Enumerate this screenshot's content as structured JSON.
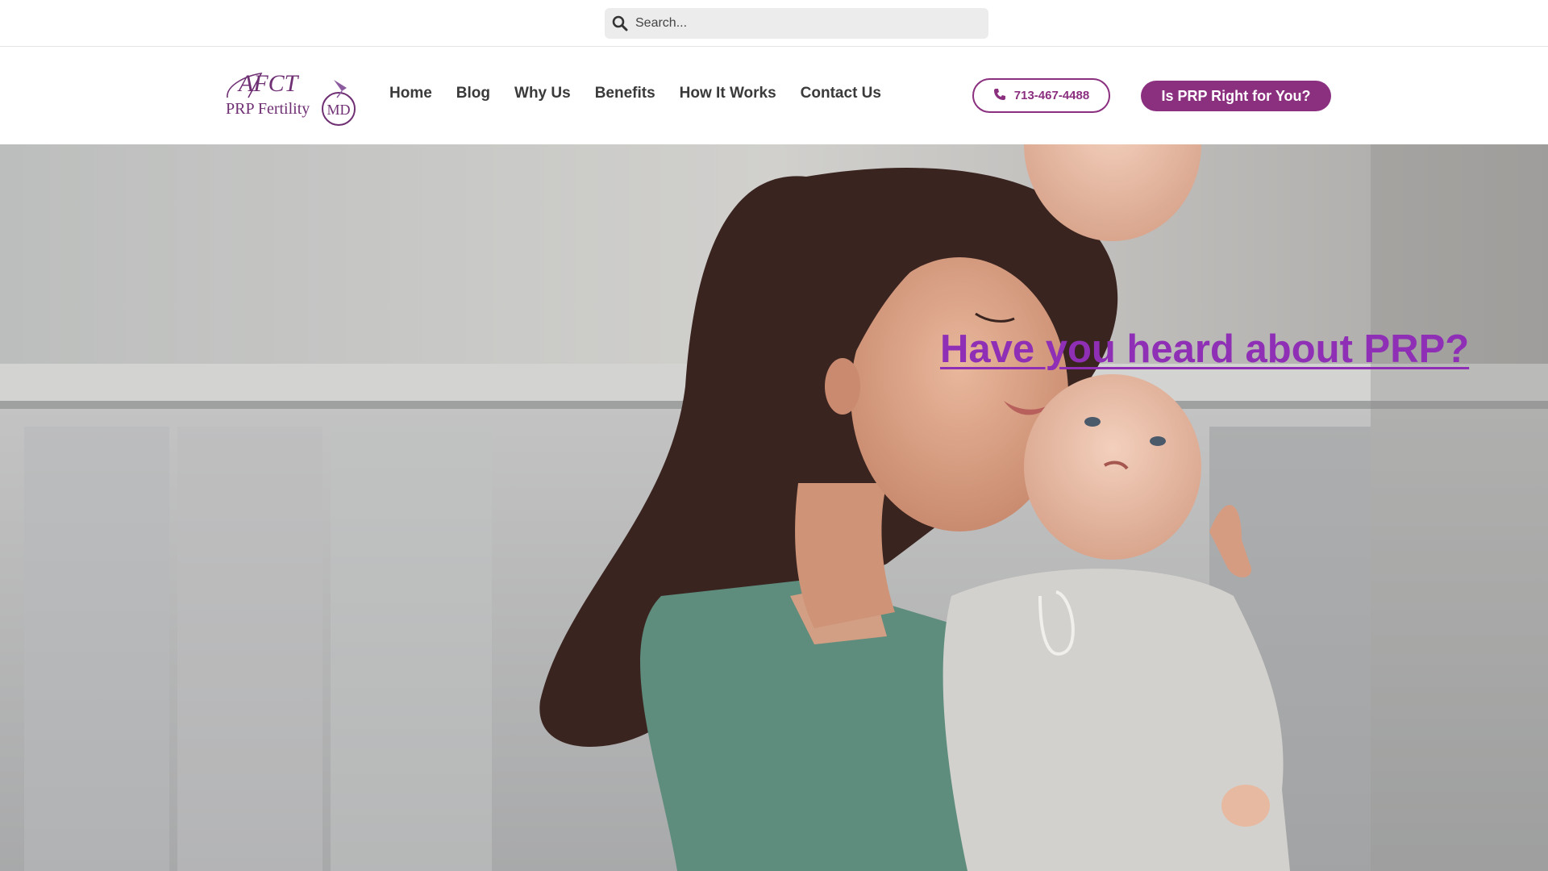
{
  "search": {
    "placeholder": "Search...",
    "icon": "search-icon"
  },
  "logo": {
    "line1": "AFCT",
    "line2": "PRP Fertility",
    "badge": "MD"
  },
  "nav": {
    "items": [
      {
        "label": "Home"
      },
      {
        "label": "Blog"
      },
      {
        "label": "Why Us"
      },
      {
        "label": "Benefits"
      },
      {
        "label": "How It Works"
      },
      {
        "label": "Contact Us"
      }
    ]
  },
  "header": {
    "phone": "713-467-4488",
    "phone_icon": "phone-icon",
    "cta_label": "Is PRP Right for You?"
  },
  "hero": {
    "title": "Have you heard about PRP?",
    "image_desc_icon": "hero-photo"
  },
  "colors": {
    "brand": "#8b2f7f",
    "hero_title": "#8e2fb5"
  }
}
